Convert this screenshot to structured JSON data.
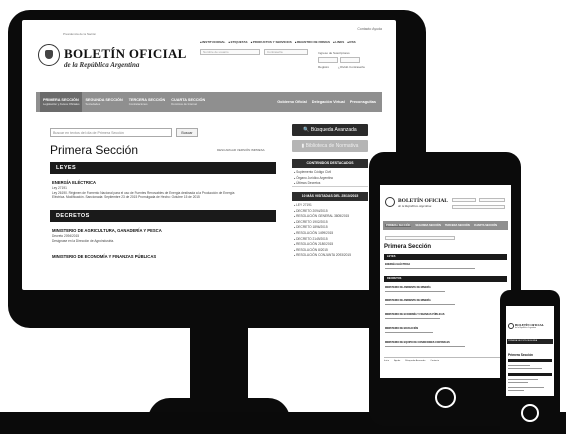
{
  "site": {
    "institution": "Presidencia de la Nación",
    "org_line1": "Oficina del Consejero Jurista del Estado",
    "org_line2": "Secretaría Legal y Técnica",
    "title": "BOLETÍN OFICIAL",
    "subtitle": "de la República Argentina"
  },
  "header": {
    "top_right": "Contacto   Ayuda",
    "top_nav": [
      "INSTITUCIONAL",
      "ETIQUETAS",
      "PRODUCTOS Y SERVICIOS",
      "REGISTRO DE FIRMAS",
      "LINKS",
      "RSS"
    ],
    "search_placeholder": "Nombre de usuario",
    "password_placeholder": "Contraseña",
    "login_label": "Ingreso de Suscriptores",
    "register_label": "Registro",
    "forgot_label": "¿Olvidó Contraseña"
  },
  "nav": {
    "tabs": [
      {
        "title": "PRIMERA SECCIÓN",
        "sub": "Legislación y Avisos Oficiales"
      },
      {
        "title": "SEGUNDA SECCIÓN",
        "sub": "Sociedades"
      },
      {
        "title": "TERCERA SECCIÓN",
        "sub": "Contrataciones"
      },
      {
        "title": "CUARTA SECCIÓN",
        "sub": "Dominios de Internet"
      }
    ],
    "right": [
      "Gobierno Oficial",
      "Delegación Virtual",
      "Preconsgultas"
    ]
  },
  "main": {
    "search_placeholder": "Buscar en textos del día de Primera Sección",
    "search_button": "Buscar",
    "heading": "Primera Sección",
    "download_pdf": "DESCARGAR VERSIÓN IMPRESA",
    "sections": [
      {
        "label": "LEYES",
        "items": [
          {
            "title": "ENERGÍA ELÉCTRICA",
            "number": "Ley 27191",
            "desc1": "Ley 26190. Régimen de Fomento Nacional para el uso de Fuentes Renovables de Energía destinada a la Producción de Energía",
            "desc2": "Eléctrica. Modificación. Sancionada: Septiembre 23 de 2015 Promulgada de Hecho: Octubre 15 de 2015"
          }
        ]
      },
      {
        "label": "DECRETOS",
        "items": [
          {
            "title": "MINISTERIO DE AGRICULTURA, GANADERÍA Y PESCA",
            "number": "Decreto 2094/2015",
            "desc1": "Desígnase en la Dirección de Agroindustria."
          },
          {
            "title": "MINISTERIO DE ECONOMÍA Y FINANZAS PÚBLICAS",
            "number": "",
            "desc1": ""
          }
        ]
      }
    ]
  },
  "sidebar": {
    "advanced_search": "Búsqueda Avanzada",
    "biblioteca": "Biblioteca de Normativa",
    "featured_title": "CONTENIDOS DESTACADOS",
    "featured_items": [
      "Suplemento Código Civil",
      "Órgano Jurídico Argentino",
      "Últimos Decretos"
    ],
    "most_visited_title": "10 MÁS VISITADAS DEL 25/10/2015",
    "most_visited_items": [
      "LEY 27191",
      "DECRETO 2094/2015",
      "RESOLUCIÓN GENERAL 3805/2015",
      "DECRETO 1902/2015",
      "DECRETO 1896/2015",
      "RESOLUCIÓN 1499/2015",
      "DECRETO 2149/2015",
      "RESOLUCIÓN 2180/2015",
      "RESOLUCIÓN 8/2015",
      "RESOLUCIÓN CONJUNTA 2093/2015"
    ]
  },
  "tablet": {
    "title": "BOLETÍN OFICIAL",
    "subtitle": "de la República Argentina",
    "nav": [
      "PRIMERA SECCIÓN",
      "SEGUNDA SECCIÓN",
      "TERCERA SECCIÓN",
      "CUARTA SECCIÓN"
    ],
    "heading": "Primera Sección",
    "bar1": "LEYES",
    "bar2": "DECRETOS",
    "items": [
      "ENERGÍA ELÉCTRICA",
      "MINISTERIO DE AMBIENTE DE MINERÍA",
      "MINISTERIO DE AMBIENTE DE MINERÍA",
      "MINISTERIO DE ECONOMÍA Y FINANZAS PÚBLICAS",
      "MINISTERIO DE EDUCACIÓN",
      "MINISTERIO DE EQUIPO DE CONDICIONES CONTABLES"
    ],
    "footer_items": [
      "Inicio",
      "Ayuda",
      "Búsqueda Avanzada",
      "Contacto"
    ]
  },
  "phone": {
    "title": "BOLETÍN OFICIAL",
    "subtitle": "de la República Argentina",
    "nav_label": "PRIMERA SECCIÓN  SEGUNDA",
    "heading": "Primera Sección"
  }
}
